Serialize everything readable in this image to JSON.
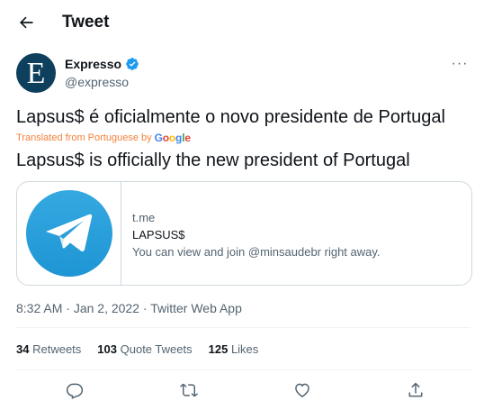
{
  "header": {
    "back_icon": "arrow-left-icon",
    "title": "Tweet"
  },
  "author": {
    "avatar_letter": "E",
    "name": "Expresso",
    "handle": "@expresso",
    "verified_icon": "verified-badge-icon",
    "more_icon": "more-options-icon",
    "more_label": "···"
  },
  "tweet": {
    "text": "Lapsus$ é oficialmente o novo presidente de Portugal",
    "translated_label": "Translated from Portuguese by",
    "translation": "Lapsus$ is officially the new president of Portugal"
  },
  "card": {
    "media_icon": "telegram-icon",
    "domain": "t.me",
    "title": "LAPSUS$",
    "description": "You can view and join @minsaudebr right away."
  },
  "meta": {
    "time": "8:32 AM",
    "date": "Jan 2, 2022",
    "source": "Twitter Web App"
  },
  "stats": {
    "retweets_count": "34",
    "retweets_label": "Retweets",
    "quotes_count": "103",
    "quotes_label": "Quote Tweets",
    "likes_count": "125",
    "likes_label": "Likes"
  },
  "actions": [
    "reply-icon",
    "retweet-icon",
    "like-icon",
    "share-icon"
  ],
  "colors": {
    "text_primary": "#0f1419",
    "text_secondary": "#536471",
    "border": "#cfd9de",
    "verified": "#1d9bf0",
    "translated": "#f4813b",
    "telegram": "#2aa3de",
    "avatar_bg": "#0e3f5c"
  }
}
